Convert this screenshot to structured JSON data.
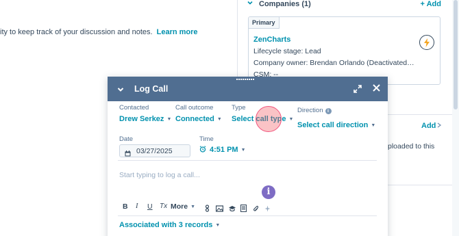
{
  "background": {
    "helper_text": "ity to keep track of your discussion and notes.",
    "learn_more": "Learn more",
    "companies_title": "Companies (1)",
    "add_label": "+ Add",
    "company_card": {
      "tag": "Primary",
      "name": "ZenCharts",
      "lifecycle": "Lifecycle stage:  Lead",
      "owner": "Company owner:  Brendan Orlando (Deactivated…",
      "csm": "CSM:  --"
    },
    "second_add": "Add",
    "uploaded_line1": "ploaded to this",
    "uploaded_line2": ""
  },
  "modal": {
    "title": "Log Call",
    "contacted": {
      "label": "Contacted",
      "value": "Drew Serkez"
    },
    "outcome": {
      "label": "Call outcome",
      "value": "Connected"
    },
    "type": {
      "label": "Type",
      "value": "Select call type"
    },
    "direction": {
      "label": "Direction",
      "value": "Select call direction"
    },
    "date": {
      "label": "Date",
      "value": "03/27/2025"
    },
    "time": {
      "label": "Time",
      "value": "4:51 PM"
    },
    "notes_placeholder": "Start typing to log a call...",
    "toolbar": {
      "bold": "B",
      "italic": "I",
      "underline": "U",
      "clear_format": "Tx",
      "more": "More"
    },
    "associated": "Associated with 3 records"
  },
  "colors": {
    "header": "#506e91",
    "link": "#0091ae",
    "info_icon": "#7e6cc4",
    "click_indicator": "#f2547d"
  }
}
